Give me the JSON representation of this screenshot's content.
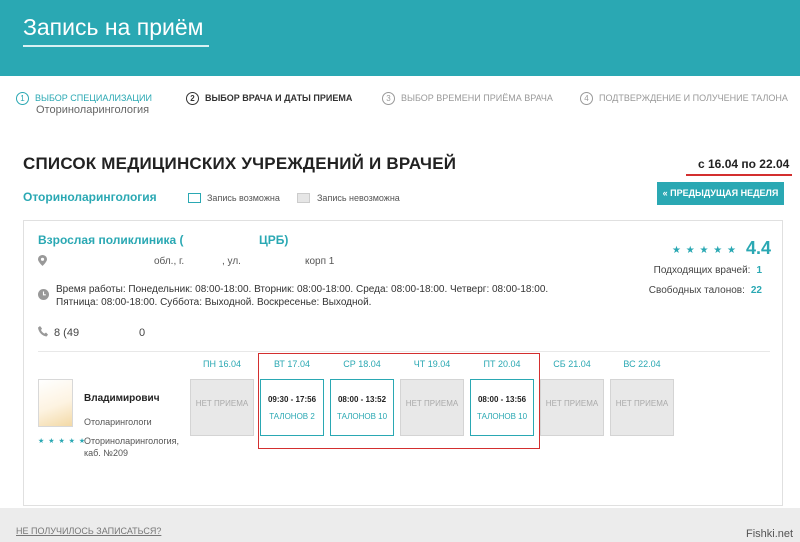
{
  "header": {
    "title": "Запись на приём"
  },
  "steps": [
    {
      "num": "1",
      "label": "Выбор специализации",
      "sub": "Оториноларингология"
    },
    {
      "num": "2",
      "label": "Выбор врача и даты приема"
    },
    {
      "num": "3",
      "label": "Выбор времени приёма врача"
    },
    {
      "num": "4",
      "label": "Подтверждение и получение талона"
    }
  ],
  "main": {
    "title": "СПИСОК МЕДИЦИНСКИХ УЧРЕЖДЕНИЙ И ВРАЧЕЙ",
    "date_range": "с 16.04 по 22.04",
    "specialty": "Оториноларингология",
    "legend_available": "Запись возможна",
    "legend_unavailable": "Запись невозможна",
    "prev_week": "« ПРЕДЫДУЩАЯ НЕДЕЛЯ"
  },
  "clinic": {
    "name": "Взрослая поликлиника (",
    "name_end": "ЦРБ)",
    "addr_region": "обл., г.",
    "addr_street": ", ул.",
    "addr_building": "корп 1",
    "hours": "Время работы: Понедельник: 08:00-18:00. Вторник: 08:00-18:00. Среда: 08:00-18:00. Четверг: 08:00-18:00. Пятница: 08:00-18:00. Суббота: Выходной. Воскресенье: Выходной.",
    "phone_start": "8 (49",
    "phone_end": "0",
    "stars": "★ ★ ★ ★ ★",
    "rating": "4.4",
    "suitable_label": "Подходящих врачей:",
    "suitable_value": "1",
    "free_label": "Свободных талонов:",
    "free_value": "22"
  },
  "doctor": {
    "name": "Владимирович",
    "role": "Отоларингологи",
    "stars": "★ ★ ★ ★ ★",
    "spec": "Оториноларингология, каб. №209"
  },
  "days": [
    {
      "head": "ПН 16.04",
      "status": "НЕТ ПРИЕМА"
    },
    {
      "head": "ВТ 17.04",
      "time": "09:30 - 17:56",
      "tickets": "ТАЛОНОВ 2"
    },
    {
      "head": "СР 18.04",
      "time": "08:00 - 13:52",
      "tickets": "ТАЛОНОВ 10"
    },
    {
      "head": "ЧТ 19.04",
      "status": "НЕТ ПРИЕМА"
    },
    {
      "head": "ПТ 20.04",
      "time": "08:00 - 13:56",
      "tickets": "ТАЛОНОВ 10"
    },
    {
      "head": "СБ 21.04",
      "status": "НЕТ ПРИЕМА"
    },
    {
      "head": "ВС 22.04",
      "status": "НЕТ ПРИЕМА"
    }
  ],
  "footer": {
    "link": "НЕ ПОЛУЧИЛОСЬ ЗАПИСАТЬСЯ?",
    "watermark": "Fishki.net"
  },
  "colors": {
    "accent": "#2aa8b3",
    "highlight": "#d32f2f"
  },
  "icons": {
    "address": "map-pin-icon",
    "hours": "clock-icon",
    "phone": "phone-icon"
  }
}
